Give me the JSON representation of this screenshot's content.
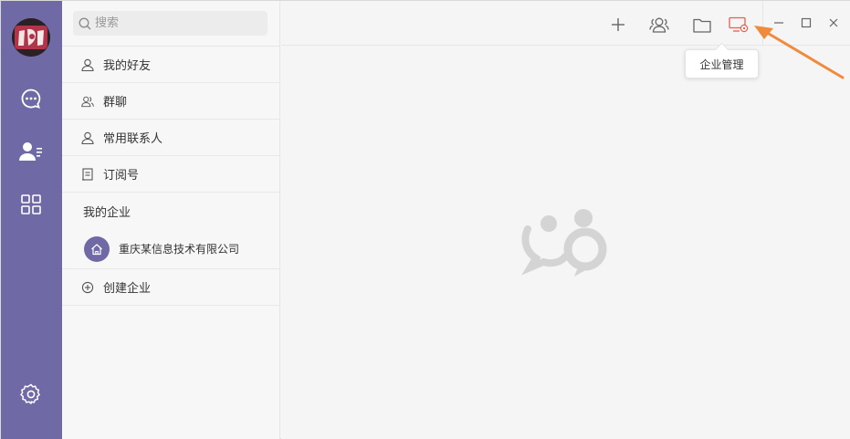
{
  "search": {
    "placeholder": "搜索"
  },
  "list": {
    "items": [
      {
        "label": "我的好友",
        "icon": "person-icon"
      },
      {
        "label": "群聊",
        "icon": "group-icon"
      },
      {
        "label": "常用联系人",
        "icon": "contact-icon"
      },
      {
        "label": "订阅号",
        "icon": "subscription-icon"
      }
    ],
    "section_title": "我的企业",
    "company": {
      "name": "重庆某信息技术有限公司",
      "icon": "home-icon"
    },
    "create": {
      "label": "创建企业",
      "icon": "plus-circle-icon"
    }
  },
  "toolbar": {
    "tooltip": "企业管理",
    "icons": [
      "plus-icon",
      "group-icon",
      "folder-icon",
      "enterprise-manage-icon"
    ],
    "window_controls": [
      "minimize-icon",
      "maximize-icon",
      "close-icon"
    ]
  },
  "rail": {
    "icons": [
      "chat-icon",
      "contacts-icon",
      "apps-icon",
      "settings-icon"
    ]
  },
  "colors": {
    "rail": "#6f6aa6",
    "accent_red": "#e8604c",
    "arrow": "#f08a3c"
  }
}
